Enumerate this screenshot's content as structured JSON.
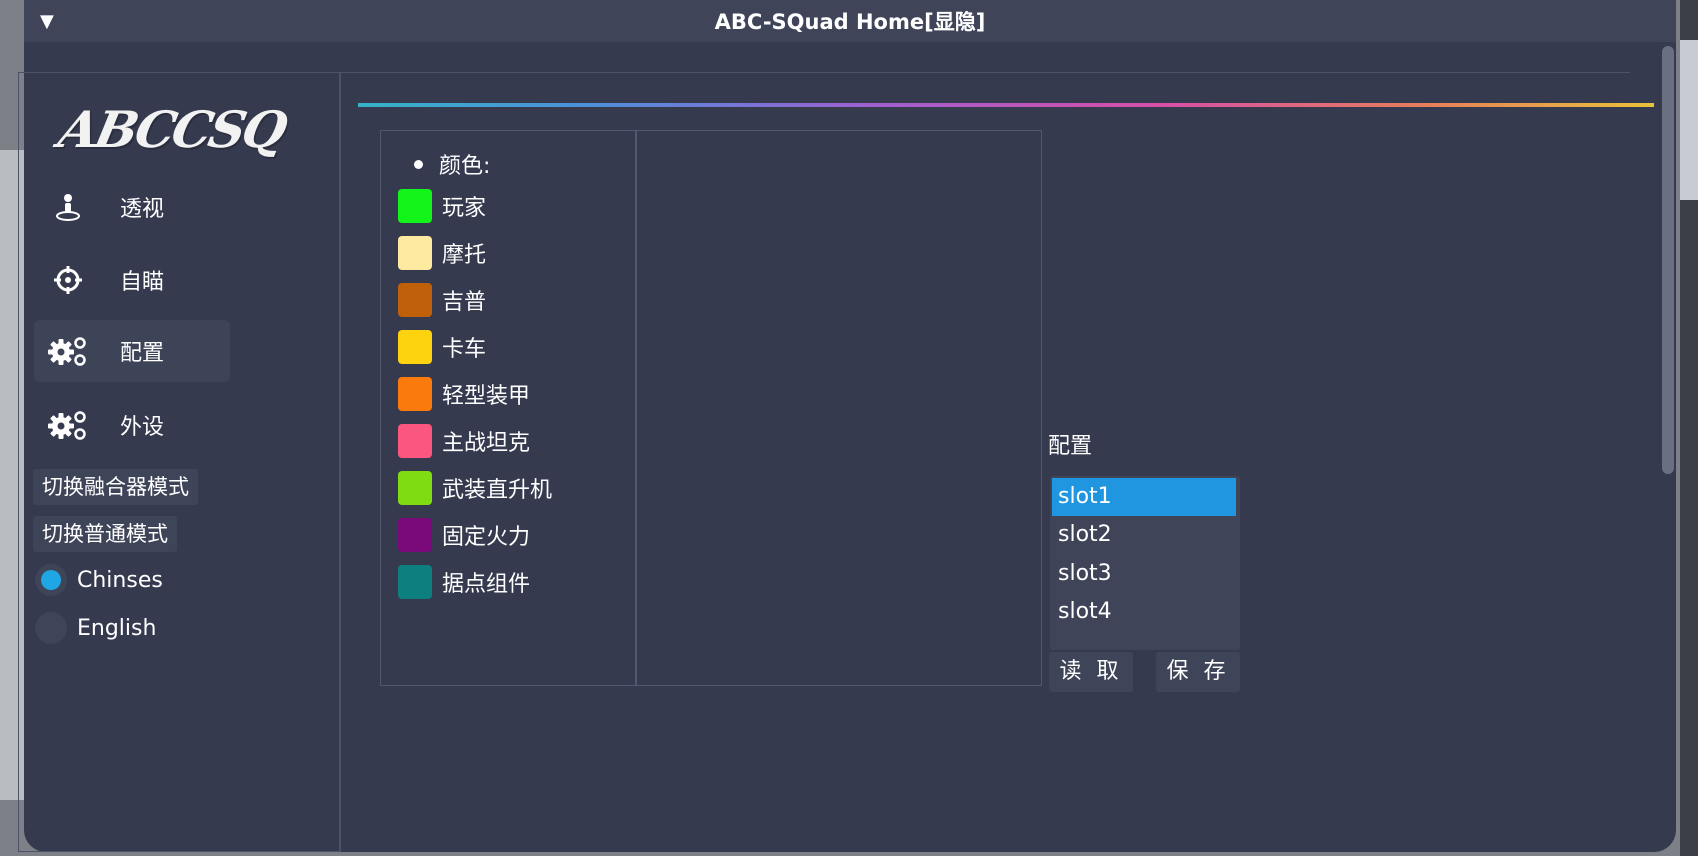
{
  "window": {
    "title": "ABC-SQuad Home[显隐]"
  },
  "sidebar": {
    "logo_text": "ABCCSQ",
    "items": [
      {
        "label": "透视",
        "icon": "person-pin-icon",
        "active": false
      },
      {
        "label": "自瞄",
        "icon": "crosshair-icon",
        "active": false
      },
      {
        "label": "配置",
        "icon": "gears-icon",
        "active": true
      },
      {
        "label": "外设",
        "icon": "gears-icon",
        "active": false
      }
    ],
    "mode_buttons": [
      "切换融合器模式",
      "切换普通模式"
    ],
    "languages": [
      {
        "label": "Chinses",
        "selected": true
      },
      {
        "label": "English",
        "selected": false
      }
    ]
  },
  "colors": {
    "header": "颜色:",
    "items": [
      {
        "label": "玩家",
        "color": "#12f41a"
      },
      {
        "label": "摩托",
        "color": "#fde9a0"
      },
      {
        "label": "吉普",
        "color": "#c0600a"
      },
      {
        "label": "卡车",
        "color": "#fdd30f"
      },
      {
        "label": "轻型装甲",
        "color": "#fb7a0c"
      },
      {
        "label": "主战坦克",
        "color": "#fa5680"
      },
      {
        "label": "武装直升机",
        "color": "#7fdc10"
      },
      {
        "label": "固定火力",
        "color": "#7a0a7a"
      },
      {
        "label": "据点组件",
        "color": "#0d7f7f"
      }
    ]
  },
  "config": {
    "label": "配置",
    "slots": [
      "slot1",
      "slot2",
      "slot3",
      "slot4"
    ],
    "selected_slot": "slot1",
    "load_label": "读 取",
    "save_label": "保 存"
  }
}
